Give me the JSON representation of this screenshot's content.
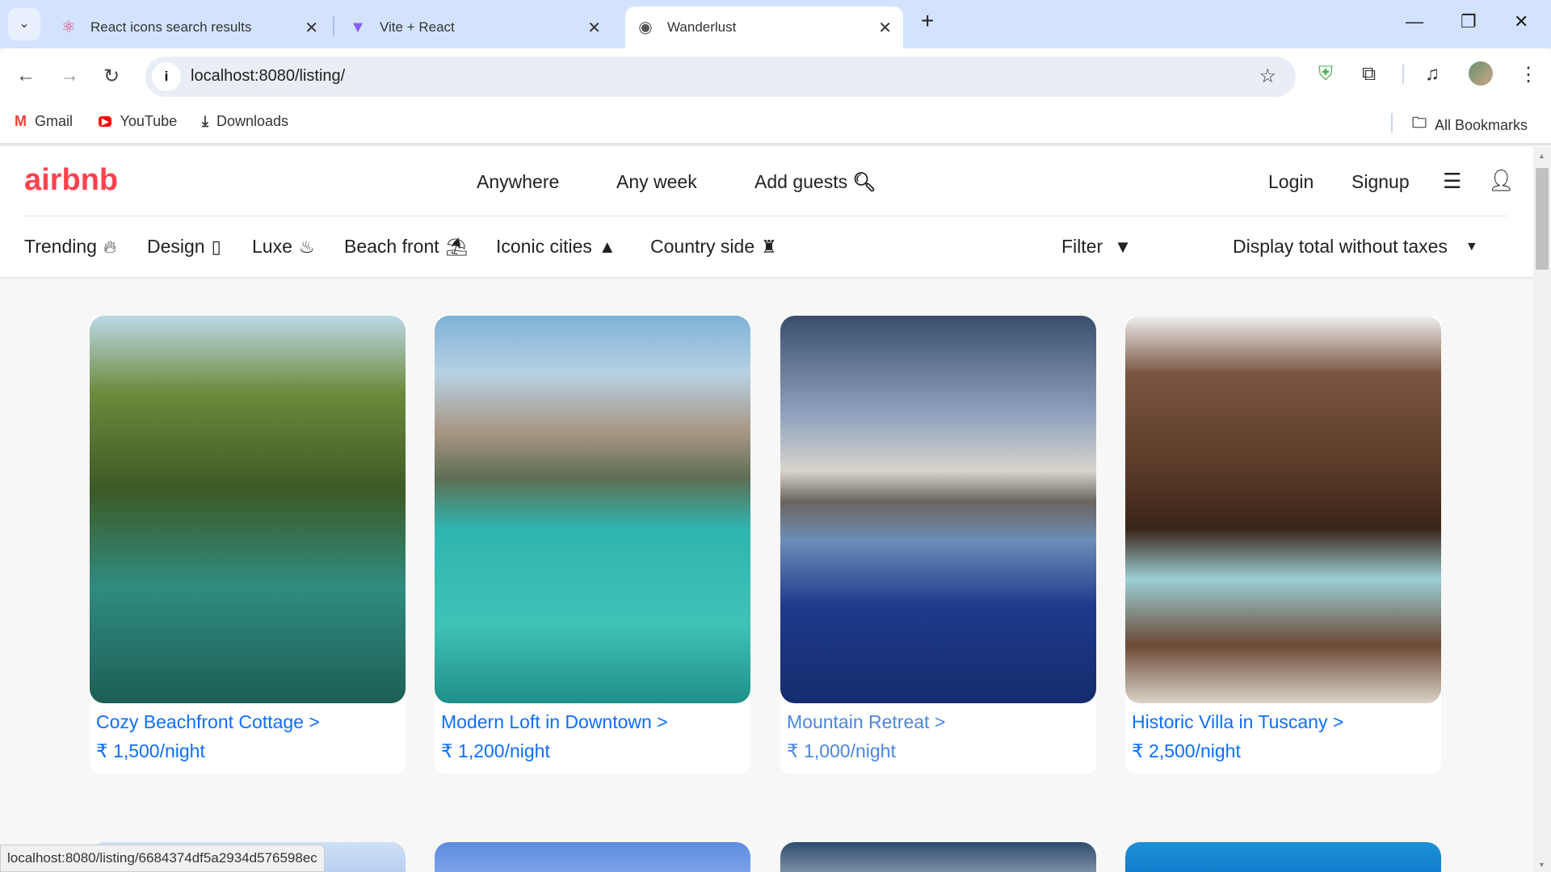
{
  "browser": {
    "tabs": [
      {
        "title": "React icons search results",
        "icon": "react-icon"
      },
      {
        "title": "Vite + React",
        "icon": "vite-icon"
      },
      {
        "title": "Wanderlust",
        "icon": "globe-icon",
        "active": true
      }
    ],
    "url": "localhost:8080/listing/",
    "bookmarks": [
      {
        "label": "Gmail"
      },
      {
        "label": "YouTube"
      },
      {
        "label": "Downloads"
      }
    ],
    "all_bookmarks": "All Bookmarks",
    "status_url": "localhost:8080/listing/6684374df5a2934d576598ec"
  },
  "nav": {
    "logo": "airbnb",
    "links": [
      "Anywhere",
      "Any week",
      "Add guests"
    ],
    "login": "Login",
    "signup": "Signup"
  },
  "categories": [
    {
      "label": "Trending",
      "icon": "fire-icon"
    },
    {
      "label": "Design",
      "icon": "building-icon"
    },
    {
      "label": "Luxe",
      "icon": "bowl-icon"
    },
    {
      "label": "Beach front",
      "icon": "umbrella-beach-icon"
    },
    {
      "label": "Iconic cities",
      "icon": "city-icon"
    },
    {
      "label": "Country side",
      "icon": "castle-icon"
    }
  ],
  "filter": {
    "label": "Filter",
    "tax_toggle": "Display total without taxes"
  },
  "listings": [
    {
      "title": "Cozy Beachfront Cottage >",
      "price": "₹ 1,500/night"
    },
    {
      "title": "Modern Loft in Downtown >",
      "price": "₹ 1,200/night"
    },
    {
      "title": "Mountain Retreat >",
      "price": "₹ 1,000/night"
    },
    {
      "title": "Historic Villa in Tuscany >",
      "price": "₹ 2,500/night"
    }
  ],
  "colors": {
    "brand": "#fe424d",
    "link": "#0d6efd",
    "tabbar": "#d3e3fd"
  }
}
